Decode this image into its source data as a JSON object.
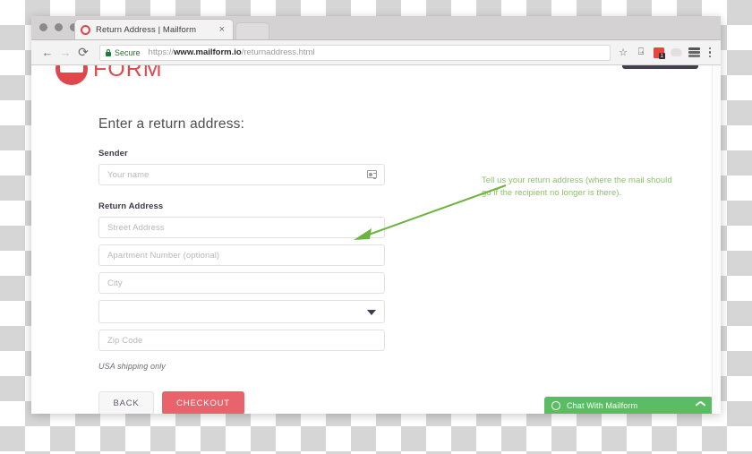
{
  "browser": {
    "tab": {
      "title": "Return Address | Mailform",
      "close_label": "×",
      "favicon": "mailform-favicon-icon"
    },
    "nav": {
      "back_glyph": "←",
      "forward_glyph": "→",
      "reload_glyph": "⟳"
    },
    "omnibox": {
      "security_label": "Secure",
      "url_scheme": "https://",
      "url_host": "www.mailform.io",
      "url_path": "/returnaddress.html",
      "full_url": "https://www.mailform.io/returnaddress.html"
    },
    "toolbar_icons": {
      "bookmark": "☆",
      "cast": "⍈",
      "extension_badge": "1",
      "menu": "kebab-menu-icon",
      "profile": "profile-avatar-icon"
    }
  },
  "page": {
    "logo_text": "FORM",
    "heading": "Enter a return address:",
    "labels": {
      "sender": "Sender",
      "return_address": "Return Address"
    },
    "fields": {
      "sender_name": {
        "value": "",
        "placeholder": "Your name"
      },
      "street": {
        "value": "",
        "placeholder": "Street Address"
      },
      "apartment": {
        "value": "",
        "placeholder": "Apartment Number (optional)"
      },
      "city": {
        "value": "",
        "placeholder": "City"
      },
      "state": {
        "value": "",
        "placeholder": ""
      },
      "zip": {
        "value": "",
        "placeholder": "Zip Code"
      }
    },
    "note": "USA shipping only",
    "buttons": {
      "back": "BACK",
      "checkout": "CHECKOUT"
    },
    "annotation": "Tell us your return address (where the mail should go if the recipient no longer is there).",
    "chat": {
      "label": "Chat With Mailform",
      "status_icon": "online-status-circle-icon",
      "toggle_icon": "chevron-up-icon"
    }
  },
  "colors": {
    "brand_red": "#e0474c",
    "checkout_red": "#e8636b",
    "annotation_green": "#8cc264",
    "chat_green": "#5bbd63",
    "secure_green": "#1f7a33",
    "header_cta_dark": "#453f4d"
  }
}
